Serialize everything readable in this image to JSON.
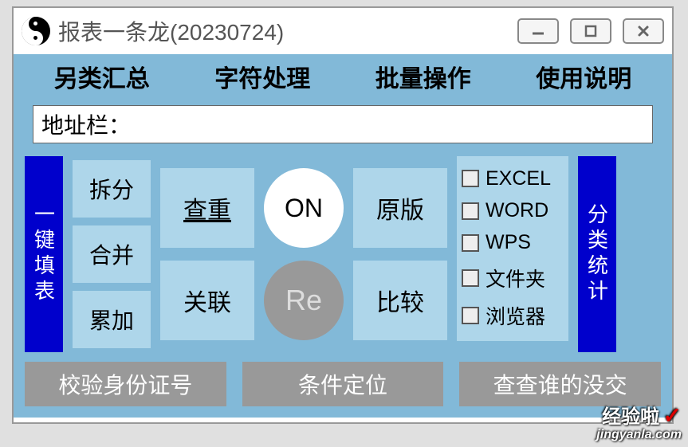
{
  "title": "报表一条龙(20230724)",
  "menu": [
    "另类汇总",
    "字符处理",
    "批量操作",
    "使用说明"
  ],
  "address_label": "地址栏：",
  "left_vertical_label": "一键填表",
  "right_vertical_label": "分类统计",
  "col1": [
    "拆分",
    "合并",
    "累加"
  ],
  "col2": [
    "查重",
    "关联"
  ],
  "circle_on": "ON",
  "circle_re": "Re",
  "col4": [
    "原版",
    "比较"
  ],
  "checklist": [
    "EXCEL",
    "WORD",
    "WPS",
    "文件夹",
    "浏览器"
  ],
  "bottom": [
    "校验身份证号",
    "条件定位",
    "查查谁的没交"
  ],
  "watermark_top": "经验啦",
  "watermark_check": "✓",
  "watermark_bot": "jingyanla.com"
}
